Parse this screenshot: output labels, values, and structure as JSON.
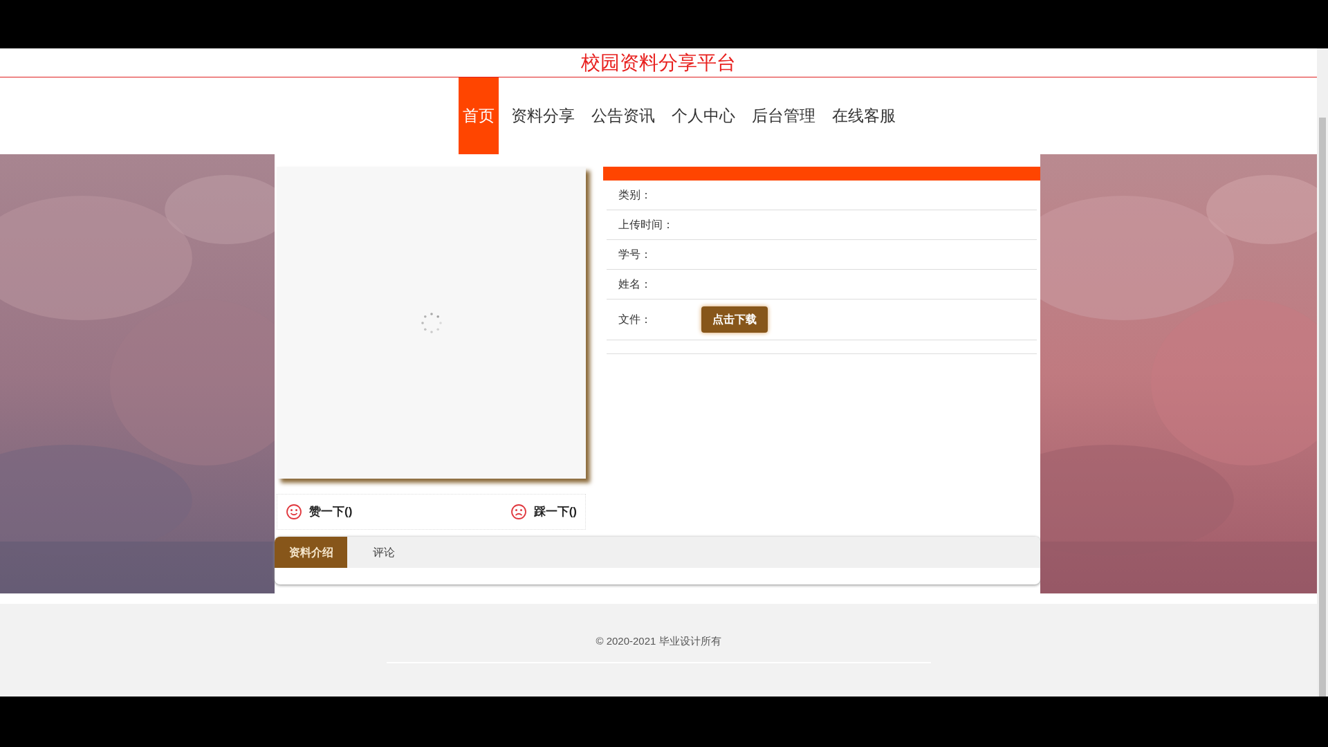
{
  "site_title": "校园资料分享平台",
  "nav": [
    {
      "label": "首页",
      "selected": true
    },
    {
      "label": "资料分享",
      "selected": false
    },
    {
      "label": "公告资讯",
      "selected": false
    },
    {
      "label": "个人中心",
      "selected": false
    },
    {
      "label": "后台管理",
      "selected": false
    },
    {
      "label": "在线客服",
      "selected": false
    }
  ],
  "details": [
    {
      "kind": "text",
      "label": "类别："
    },
    {
      "kind": "text",
      "label": "上传时间："
    },
    {
      "kind": "text",
      "label": "学号："
    },
    {
      "kind": "text",
      "label": "姓名："
    },
    {
      "kind": "file",
      "label": "文件：",
      "button": "点击下载"
    }
  ],
  "votes": [
    {
      "kind": "like",
      "label": "赞一下()"
    },
    {
      "kind": "dislike",
      "label": "踩一下()"
    }
  ],
  "tabs": [
    {
      "label": "资料介绍",
      "selected": true
    },
    {
      "label": "评论",
      "selected": false
    }
  ],
  "footer": {
    "copyright": "© 2020-2021 毕业设计所有"
  }
}
